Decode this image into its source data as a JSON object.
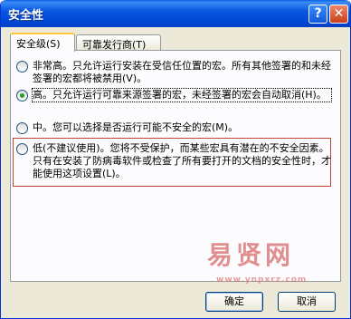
{
  "window": {
    "title": "安全性",
    "help_label": "?",
    "close_label": "✕"
  },
  "tabs": [
    {
      "label": "安全级(S)",
      "active": true
    },
    {
      "label": "可靠发行商(T)",
      "active": false
    }
  ],
  "options": [
    {
      "text": "非常高。只允许运行安装在受信任位置的宏。所有其他签署的和未经签署的宏都将被禁用(V)。",
      "checked": false
    },
    {
      "text": "高。只允许运行可靠来源签署的宏，未经签署的宏会自动取消(H)。",
      "checked": true
    },
    {
      "text": "中。您可以选择是否运行可能不安全的宏(M)。",
      "checked": false
    },
    {
      "text": "低(不建议使用)。您将不受保护，而某些宏具有潜在的不安全因素。只有在安装了防病毒软件或检查了所有要打开的文档的安全性时，才能使用这项设置(L)。",
      "checked": false
    }
  ],
  "watermark": {
    "text": "易贤网",
    "url": "www.ynpxrz.com"
  },
  "buttons": {
    "ok": "确定",
    "cancel": "取消"
  },
  "colors": {
    "title_bar": "#0a57e0",
    "dialog_bg": "#ece9d8",
    "warn_frame": "#c0453a"
  }
}
